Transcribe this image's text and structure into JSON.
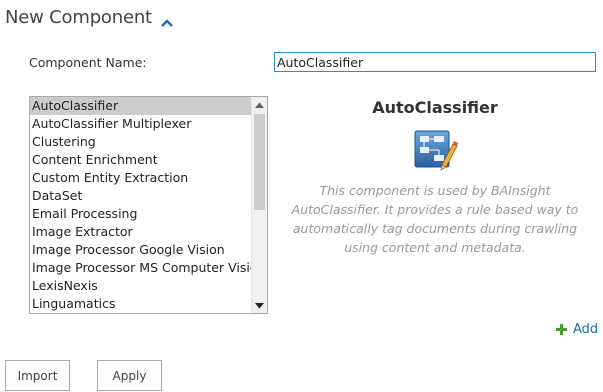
{
  "header": {
    "title": "New Component"
  },
  "form": {
    "name_label": "Component Name:",
    "name_value": "AutoClassifier"
  },
  "list": {
    "selected_index": 0,
    "items": [
      "AutoClassifier",
      "AutoClassifier Multiplexer",
      "Clustering",
      "Content Enrichment",
      "Custom Entity Extraction",
      "DataSet",
      "Email Processing",
      "Image Extractor",
      "Image Processor Google Vision",
      "Image Processor MS Computer Vision",
      "LexisNexis",
      "Linguamatics"
    ]
  },
  "detail": {
    "title": "AutoClassifier",
    "icon": "component-diagram-icon",
    "description": "This component is used by BAInsight AutoClassifier. It provides a rule based way to automatically tag documents during crawling using content and metadata."
  },
  "actions": {
    "add_label": "Add",
    "import_label": "Import",
    "apply_label": "Apply"
  },
  "colors": {
    "accent": "#1d6fa8",
    "input_border": "#2a8dd4",
    "selected_bg": "#cccccc",
    "add_icon": "#4a9a2e"
  }
}
